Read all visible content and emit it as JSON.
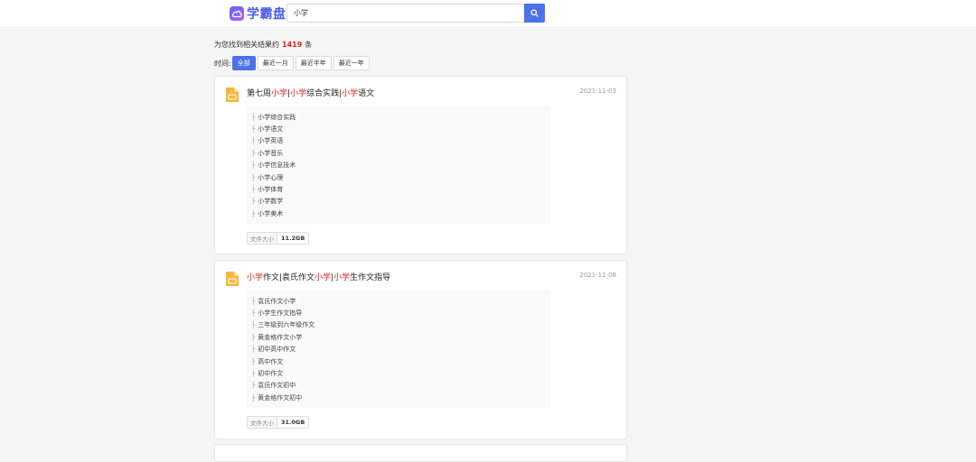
{
  "header": {
    "logo_text": "学霸盘",
    "search_value": "小学",
    "search_button_icon": "search-icon"
  },
  "results": {
    "prefix": "为您找到相关结果约",
    "count": "1419",
    "suffix": "条"
  },
  "time_filter": {
    "label": "时间:",
    "options": [
      "全部",
      "最近一月",
      "最近半年",
      "最近一年"
    ],
    "selected": "全部"
  },
  "cards": [
    {
      "title_parts": [
        "第七周",
        "小学",
        "|",
        "小学",
        "综合实践|",
        "小学",
        "语文"
      ],
      "date": "2021-11-03",
      "files": [
        "小学综合实践",
        "小学语文",
        "小学英语",
        "小学音乐",
        "小学信息技术",
        "小学心理",
        "小学体育",
        "小学数学",
        "小学美术"
      ],
      "size_label": "文件大小",
      "size_value": "11.2GB"
    },
    {
      "title_parts": [
        "",
        "小学",
        "作文|袁氏作文",
        "小学",
        "|",
        "小学",
        "生作文指导"
      ],
      "date": "2021-11-08",
      "files": [
        "袁氏作文小学",
        "小学生作文指导",
        "三年级到六年级作文",
        "黄金格作文小学",
        "初中高中作文",
        "高中作文",
        "初中作文",
        "袁氏作文初中",
        "黄金格作文初中"
      ],
      "size_label": "文件大小",
      "size_value": "31.0GB"
    }
  ],
  "colors": {
    "accent": "#4b72e8",
    "highlight": "#e02020",
    "folder": "#f5b83d"
  }
}
